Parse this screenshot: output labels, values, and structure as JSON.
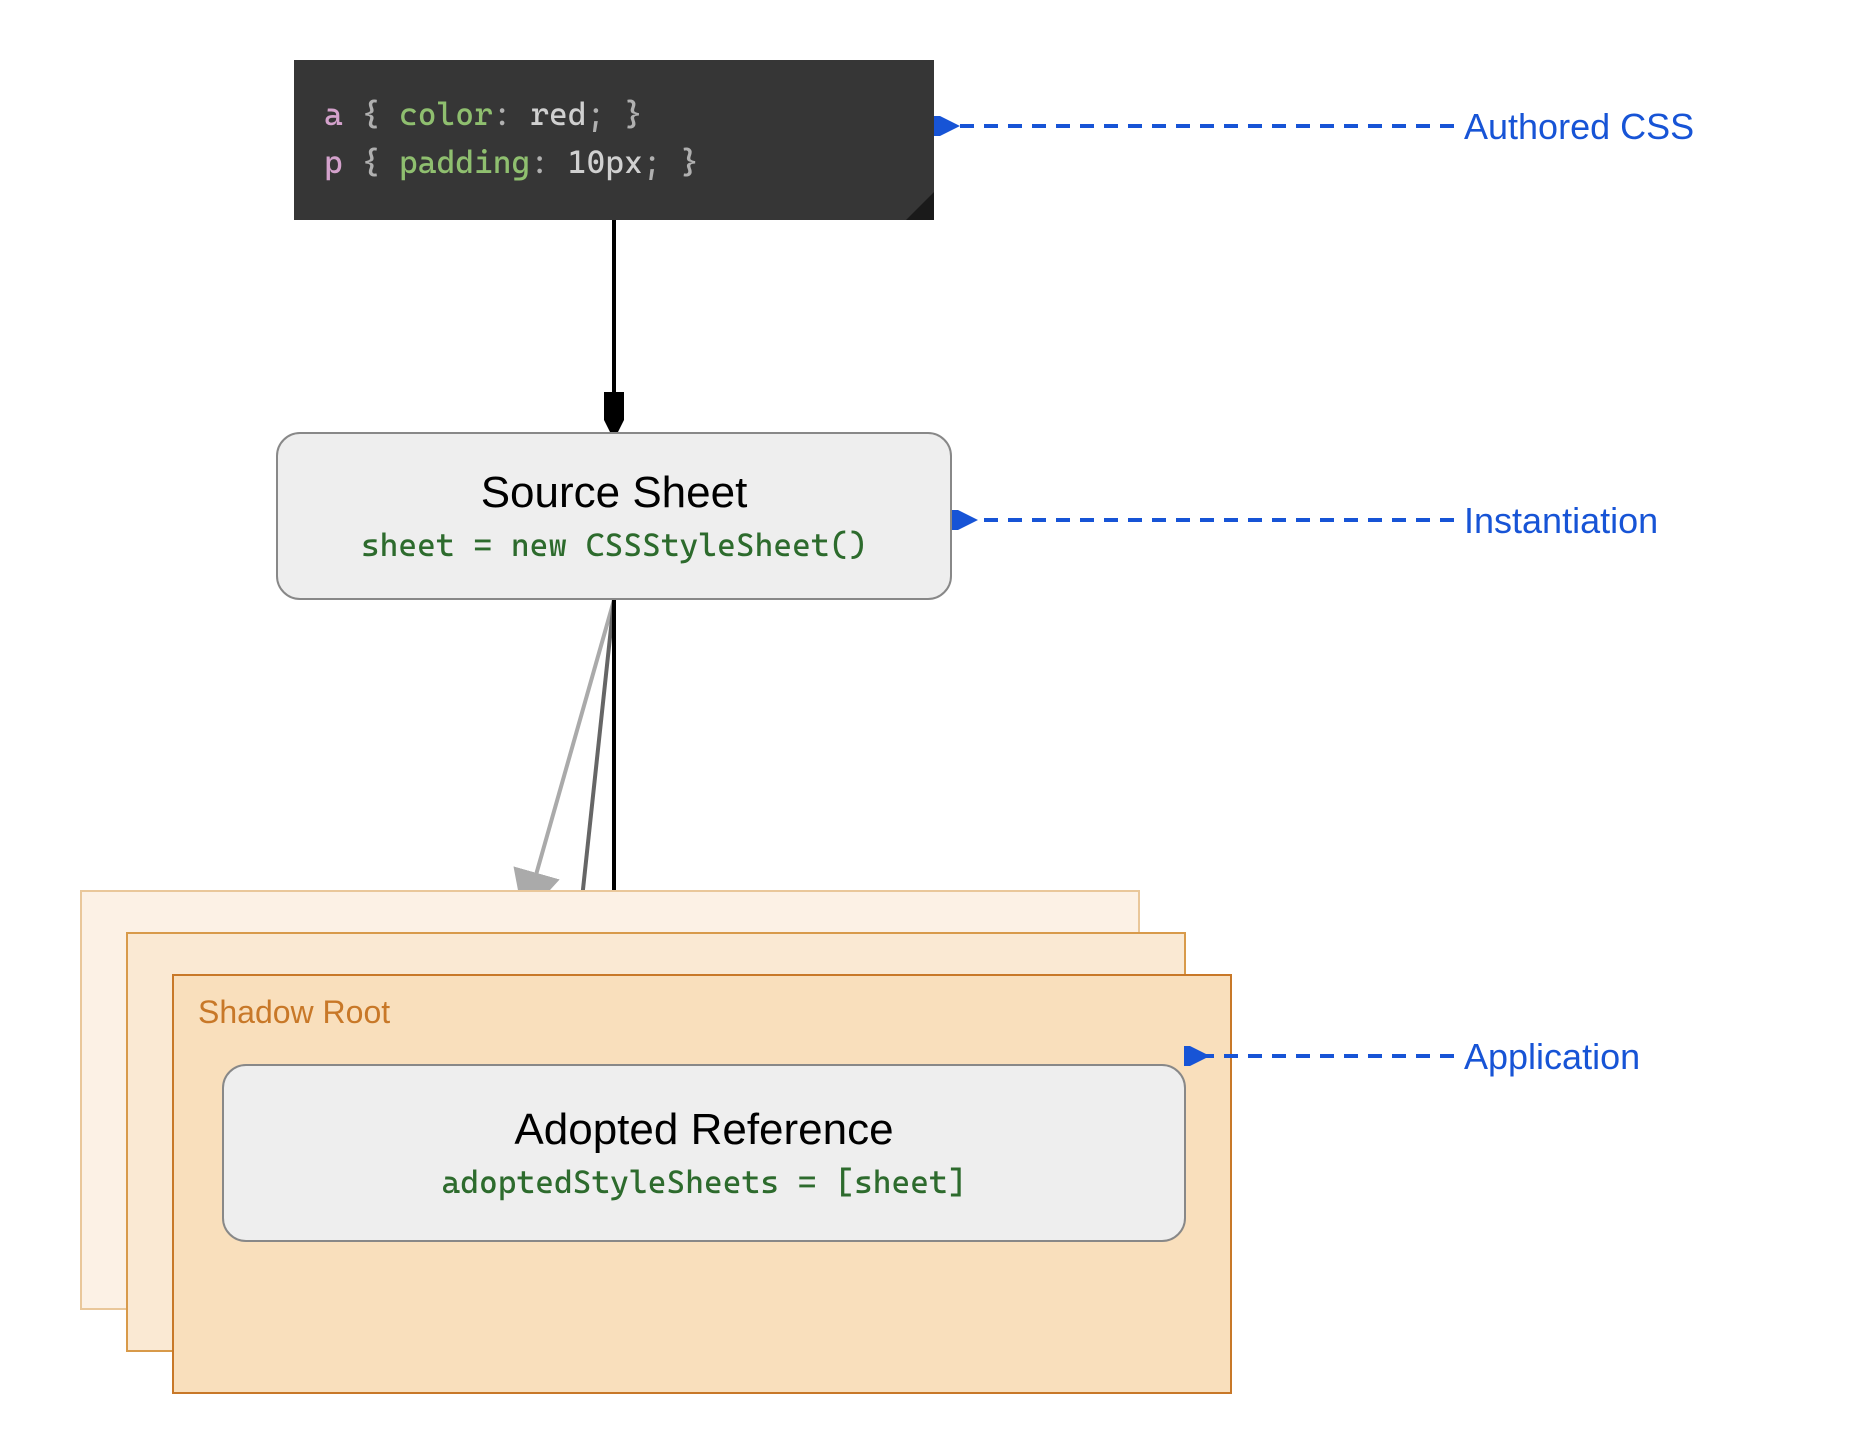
{
  "code": {
    "line1_selector": "a",
    "line1_brace_open": "{",
    "line1_property": "color",
    "line1_colon": ":",
    "line1_value": "red",
    "line1_semi": ";",
    "line1_brace_close": "}",
    "line2_selector": "p",
    "line2_brace_open": "{",
    "line2_property": "padding",
    "line2_colon": ":",
    "line2_value": "10px",
    "line2_semi": ";",
    "line2_brace_close": "}"
  },
  "source_sheet": {
    "title": "Source Sheet",
    "code": "sheet = new CSSStyleSheet()"
  },
  "shadow_root": {
    "label": "Shadow Root"
  },
  "adopted_ref": {
    "title": "Adopted Reference",
    "code": "adoptedStyleSheets = [sheet]"
  },
  "annotations": {
    "authored_css": "Authored CSS",
    "instantiation": "Instantiation",
    "application": "Application"
  }
}
